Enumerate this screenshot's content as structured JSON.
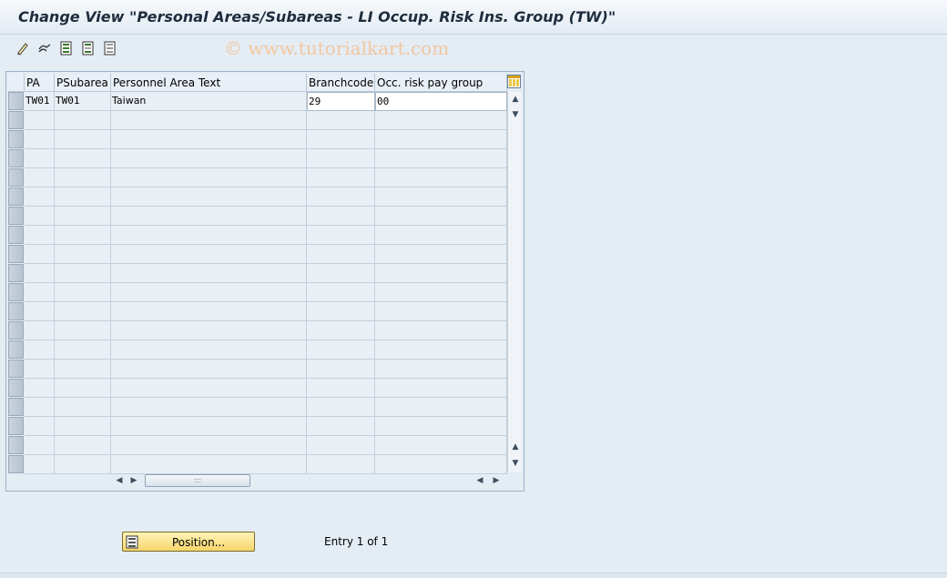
{
  "window": {
    "title": "Change View \"Personal Areas/Subareas - LI Occup. Risk Ins. Group (TW)\""
  },
  "watermark": "© www.tutorialkart.com",
  "toolbar": {
    "icons": [
      "edit-pencil-icon",
      "other-entry-icon",
      "select-all-icon",
      "select-block-icon",
      "deselect-all-icon"
    ]
  },
  "table": {
    "columns": [
      "PA",
      "PSubarea",
      "Personnel Area Text",
      "Branchcode",
      "Occ. risk pay group"
    ],
    "rows": [
      [
        "TW01",
        "TW01",
        "Taiwan",
        "29",
        "00"
      ]
    ],
    "empty_rows": 19
  },
  "footer": {
    "position_button": "Position...",
    "entry_text": "Entry 1 of 1"
  },
  "colors": {
    "background": "#e4ecf4",
    "title": "#1e2c3c",
    "button": "#f6d56a"
  }
}
